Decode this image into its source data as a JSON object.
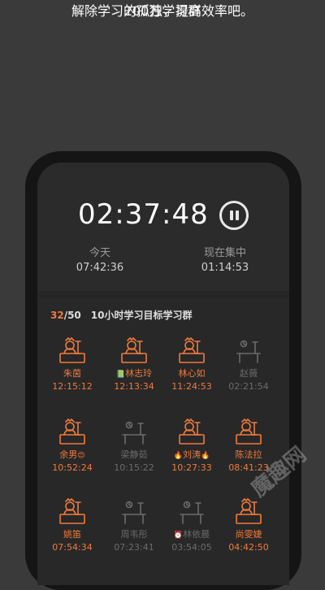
{
  "promo": {
    "line1": "解除学习的孤独，提高效率吧。",
    "line2": "200万学习群"
  },
  "timer": {
    "elapsed": "02:37:48",
    "today_label": "今天",
    "today_value": "07:42:36",
    "focus_label": "现在集中",
    "focus_value": "01:14:53"
  },
  "group": {
    "current": "32",
    "total": "/50",
    "name": "10小时学习目标学习群"
  },
  "members": [
    {
      "name": "朱茵",
      "time": "12:15:12",
      "active": true
    },
    {
      "name": "林志玲",
      "time": "12:13:34",
      "active": true,
      "prefix_icon": "book-icon"
    },
    {
      "name": "林心如",
      "time": "11:24:53",
      "active": true
    },
    {
      "name": "赵薇",
      "time": "02:21:54",
      "active": false
    },
    {
      "name": "余男",
      "time": "10:52:24",
      "active": true,
      "suffix_icon": "emoji-icon"
    },
    {
      "name": "梁静茹",
      "time": "10:15:22",
      "active": false
    },
    {
      "name": "刘涛",
      "time": "10:27:33",
      "active": true,
      "prefix_icon": "fire-icon",
      "suffix_icon": "fire-icon"
    },
    {
      "name": "陈法拉",
      "time": "08:41:23",
      "active": true
    },
    {
      "name": "姚笛",
      "time": "07:54:34",
      "active": true
    },
    {
      "name": "周韦彤",
      "time": "07:23:41",
      "active": false
    },
    {
      "name": "林依晨",
      "time": "03:54:05",
      "active": false,
      "prefix_icon": "alarm-icon"
    },
    {
      "name": "尚雯婕",
      "time": "04:42:50",
      "active": true
    }
  ],
  "watermark": "魔趣网",
  "colors": {
    "accent": "#f07a3c",
    "inactive": "#6b6b6b",
    "background": "#3a3a3a"
  }
}
